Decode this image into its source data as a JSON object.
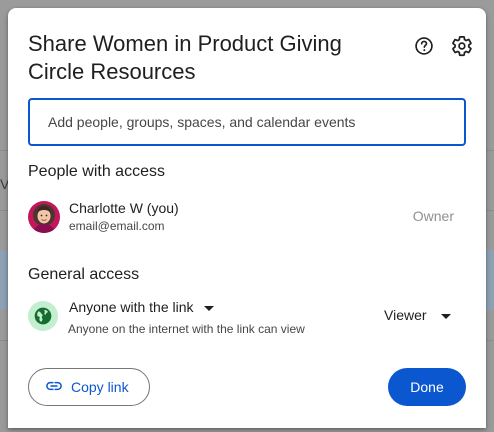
{
  "dialog": {
    "title": "Share Women in Product Giving Circle Resources"
  },
  "search": {
    "placeholder": "Add people, groups, spaces, and calendar events"
  },
  "people_section": {
    "heading": "People with access",
    "members": [
      {
        "name": "Charlotte W (you)",
        "email": "email@email.com",
        "role": "Owner"
      }
    ]
  },
  "general_access": {
    "heading": "General access",
    "access_level": "Anyone with the link",
    "description": "Anyone on the internet with the link can view",
    "role": "Viewer"
  },
  "footer": {
    "copy_link_label": "Copy link",
    "done_label": "Done"
  },
  "background": {
    "left_fragment": "V"
  },
  "colors": {
    "accent": "#0b57d0",
    "globe_bg": "#c4eed0",
    "globe_icon": "#146c2e",
    "owner_text": "#8e918f"
  },
  "icons": {
    "help": "help-circle-icon",
    "settings": "gear-icon",
    "globe": "globe-icon",
    "link": "link-icon",
    "caret": "caret-down-icon"
  }
}
